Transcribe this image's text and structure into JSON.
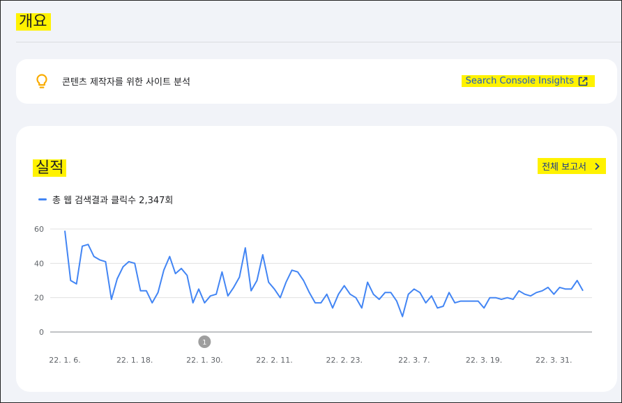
{
  "header": {
    "title": "개요"
  },
  "insights": {
    "text": "콘텐츠 제작자를 위한 사이트 분석",
    "link_label": "Search Console Insights"
  },
  "performance": {
    "title": "실적",
    "full_report_label": "전체 보고서",
    "legend_label": "총 웹 검색결과 클릭수 2,347회"
  },
  "colors": {
    "series": "#4285f4",
    "highlight": "#fff200",
    "bulb": "#f9ab00"
  },
  "chart_data": {
    "type": "line",
    "series": [
      {
        "name": "총 웹 검색결과 클릭수 2,347회",
        "values": [
          59,
          30,
          28,
          50,
          51,
          44,
          42,
          41,
          19,
          31,
          38,
          41,
          40,
          24,
          24,
          17,
          23,
          36,
          44,
          34,
          37,
          33,
          17,
          25,
          17,
          21,
          22,
          35,
          21,
          26,
          32,
          49,
          24,
          30,
          45,
          29,
          25,
          20,
          29,
          36,
          35,
          30,
          23,
          17,
          17,
          22,
          14,
          22,
          27,
          22,
          20,
          14,
          29,
          22,
          19,
          23,
          23,
          18,
          9,
          22,
          25,
          23,
          17,
          21,
          14,
          15,
          23,
          17,
          18,
          18,
          18,
          18,
          14,
          20,
          20,
          19,
          20,
          19,
          24,
          22,
          21,
          23,
          24,
          26,
          22,
          26,
          25,
          25,
          30,
          24
        ]
      }
    ],
    "x_tick_labels": [
      "22. 1. 6.",
      "22. 1. 18.",
      "22. 1. 30.",
      "22. 2. 11.",
      "22. 2. 23.",
      "22. 3. 7.",
      "22. 3. 19.",
      "22. 3. 31."
    ],
    "y_ticks": [
      0,
      20,
      40,
      60
    ],
    "ylim": [
      0,
      60
    ],
    "annotations": [
      {
        "label": "1",
        "date": "22. 1. 30."
      }
    ],
    "grid": true
  }
}
